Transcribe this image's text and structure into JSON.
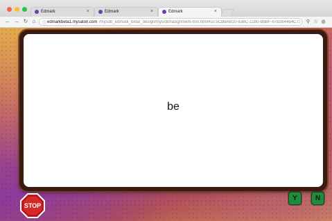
{
  "browser": {
    "tabs": [
      {
        "label": "Edmark"
      },
      {
        "label": "Edmark"
      },
      {
        "label": "Edmark"
      }
    ],
    "url": {
      "host": "edmarkbeta1.mysatori.com",
      "path": "/mysdb_edmark_beta/_design/mys/dohasignment-min.html#us:5CB8AB10-63BC-2280-B8BF-67B364464C73"
    }
  },
  "card": {
    "word": "be"
  },
  "controls": {
    "stop_label": "STOP",
    "yes_label": "Y",
    "no_label": "N"
  }
}
